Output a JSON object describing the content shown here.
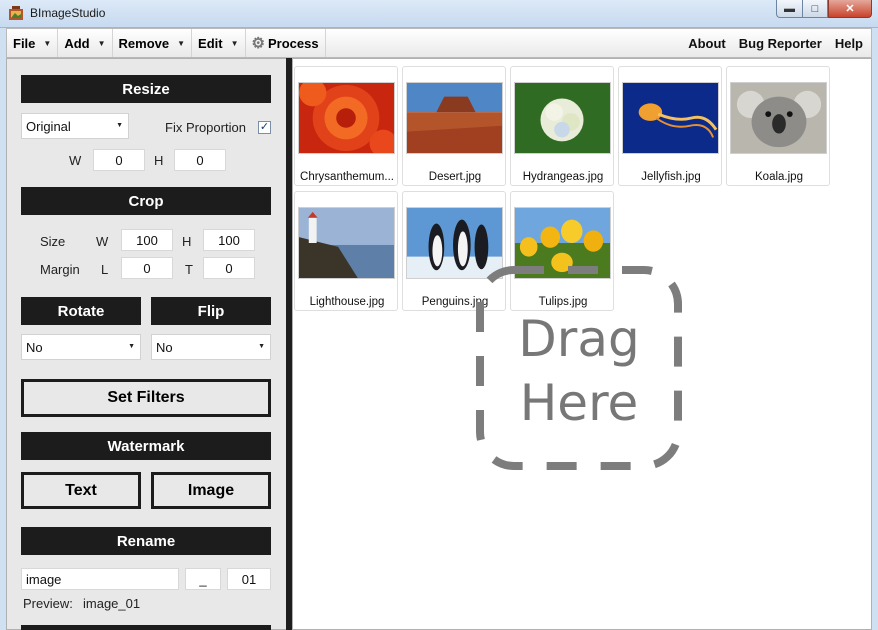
{
  "window": {
    "title": "BImageStudio"
  },
  "menu": {
    "left": [
      {
        "label": "File",
        "dropdown": true
      },
      {
        "label": "Add",
        "dropdown": true
      },
      {
        "label": "Remove",
        "dropdown": true
      },
      {
        "label": "Edit",
        "dropdown": true
      }
    ],
    "process": "Process",
    "right": [
      "About",
      "Bug Reporter",
      "Help"
    ]
  },
  "resize": {
    "header": "Resize",
    "mode": "Original",
    "fix_proportion_label": "Fix Proportion",
    "fix_proportion_checked": true,
    "w_label": "W",
    "w": "0",
    "h_label": "H",
    "h": "0"
  },
  "crop": {
    "header": "Crop",
    "size_label": "Size",
    "margin_label": "Margin",
    "w_label": "W",
    "w": "100",
    "h_label": "H",
    "h": "100",
    "l_label": "L",
    "l": "0",
    "t_label": "T",
    "t": "0"
  },
  "rotate": {
    "header": "Rotate",
    "value": "No"
  },
  "flip": {
    "header": "Flip",
    "value": "No"
  },
  "filters": {
    "button": "Set Filters"
  },
  "watermark": {
    "header": "Watermark",
    "text_button": "Text",
    "image_button": "Image"
  },
  "rename": {
    "header": "Rename",
    "name": "image",
    "separator": "_",
    "start": "01",
    "preview_label": "Preview:",
    "preview_value": "image_01"
  },
  "images": [
    {
      "name": "Chrysanthemum...",
      "thumb": "chrysanthemum"
    },
    {
      "name": "Desert.jpg",
      "thumb": "desert"
    },
    {
      "name": "Hydrangeas.jpg",
      "thumb": "hydrangeas"
    },
    {
      "name": "Jellyfish.jpg",
      "thumb": "jellyfish"
    },
    {
      "name": "Koala.jpg",
      "thumb": "koala"
    },
    {
      "name": "Lighthouse.jpg",
      "thumb": "lighthouse"
    },
    {
      "name": "Penguins.jpg",
      "thumb": "penguins"
    },
    {
      "name": "Tulips.jpg",
      "thumb": "tulips"
    }
  ],
  "dropzone": {
    "line1": "Drag",
    "line2": "Here"
  }
}
